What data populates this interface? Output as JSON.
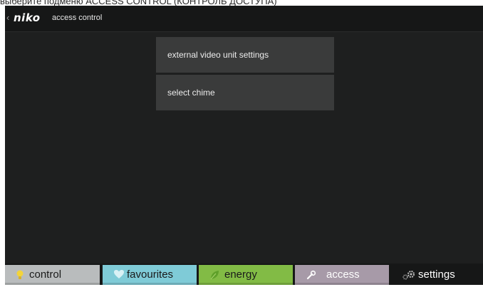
{
  "caption": {
    "text": "выберите подменю ACCESS CONTROL (КОНТРОЛЬ ДОСТУПА)"
  },
  "topbar": {
    "back_icon": "chevron-left-icon",
    "brand": "niko",
    "title": "access control"
  },
  "menu": {
    "items": [
      {
        "label": "external video unit settings"
      },
      {
        "label": "select chime"
      }
    ]
  },
  "tabs": [
    {
      "label": "control",
      "icon": "lightbulb-icon",
      "color": "#b9bcbd"
    },
    {
      "label": "favourites",
      "icon": "heart-icon",
      "color": "#7fcbd7"
    },
    {
      "label": "energy",
      "icon": "leaf-icon",
      "color": "#82bb45"
    },
    {
      "label": "access",
      "icon": "wrench-icon",
      "color": "#a79aa8"
    },
    {
      "label": "settings",
      "icon": "gears-icon",
      "color": "#161717"
    }
  ]
}
